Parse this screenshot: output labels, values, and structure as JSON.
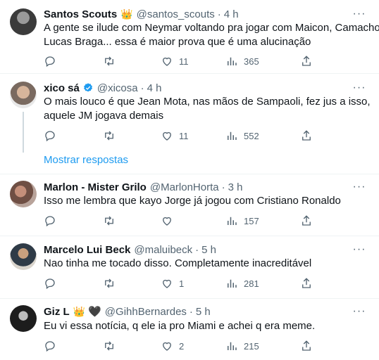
{
  "tweets": [
    {
      "name": "Santos Scouts",
      "handle": "@santos_scouts",
      "time": "4 h",
      "lines": [
        "A gente se ilude com Neymar voltando pra jogar com Maicon, Camacho,",
        "Lucas Braga... essa é maior prova que é uma alucinação"
      ],
      "likes": "11",
      "views": "365",
      "badge": "crown"
    },
    {
      "name": "xico sá",
      "handle": "@xicosa",
      "time": "4 h",
      "lines": [
        "O mais louco é que Jean Mota, nas mãos de Sampaoli, fez jus a isso,",
        "aquele JM jogava demais"
      ],
      "likes": "11",
      "views": "552",
      "badge": "verified"
    },
    {
      "name": "Marlon - Mister Grilo",
      "handle": "@MarlonHorta",
      "time": "3 h",
      "lines": [
        "Isso me lembra que kayo Jorge já jogou com Cristiano Ronaldo"
      ],
      "likes": "",
      "views": "157"
    },
    {
      "name": "Marcelo Lui Beck",
      "handle": "@maluibeck",
      "time": "5 h",
      "lines": [
        "Nao tinha me tocado disso. Completamente inacreditável"
      ],
      "likes": "1",
      "views": "281"
    },
    {
      "name": "Giz L",
      "handle": "@GihhBernardes",
      "time": "5 h",
      "lines": [
        "Eu vi essa notícia, q ele ia pro Miami e achei q era meme."
      ],
      "likes": "2",
      "views": "215",
      "badge": "crown-heart"
    }
  ],
  "show_replies_label": "Mostrar respostas",
  "icons": {
    "crown": "👑",
    "heart_black": "🖤",
    "more": "···",
    "reply": "reply-icon",
    "retweet": "retweet-icon",
    "like": "like-icon",
    "views": "views-icon",
    "share": "share-icon"
  },
  "colors": {
    "text": "#0f1419",
    "secondary": "#536471",
    "accent": "#1d9bf0",
    "divider": "#eff3f4"
  }
}
